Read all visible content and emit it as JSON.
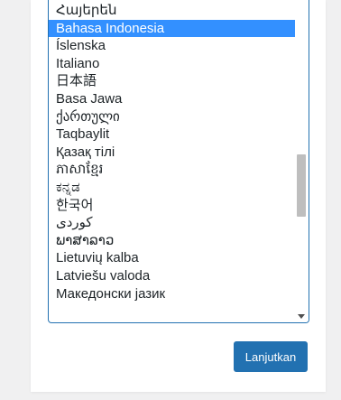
{
  "language_list": {
    "options": [
      "Հայերեն",
      "Bahasa Indonesia",
      "Íslenska",
      "Italiano",
      "日本語",
      "Basa Jawa",
      "ქართული",
      "Taqbaylit",
      "Қазақ тілі",
      "ភាសាខ្មែរ",
      "ಕನ್ನಡ",
      "한국어",
      "کوردی",
      "ພາສາລາວ",
      "Lietuvių kalba",
      "Latviešu valoda",
      "Македонски јазик"
    ],
    "selected": "Bahasa Indonesia",
    "scroll_position": 0.62,
    "visible_fraction": 0.2
  },
  "colors": {
    "selected_bg": "#3390ff",
    "button_bg": "#2271b1",
    "listbox_border": "#2271b1"
  },
  "continue_button": {
    "label": "Lanjutkan"
  }
}
